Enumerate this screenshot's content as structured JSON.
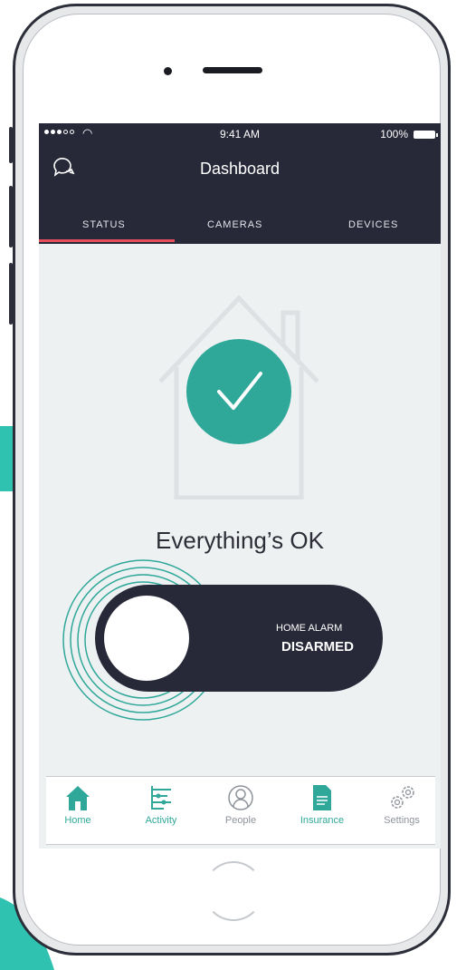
{
  "colors": {
    "accent_teal": "#2fa899",
    "navbar_dark": "#272838",
    "tab_underline": "#e84d5b",
    "screen_bg": "#eef1f2"
  },
  "status_bar": {
    "time": "9:41 AM",
    "battery_percent": "100%",
    "wifi_icon": "wifi-icon",
    "signal_icon": "signal-dots-icon"
  },
  "header": {
    "title": "Dashboard",
    "chat_icon": "chat-bubbles-icon"
  },
  "tabs": [
    {
      "label": "STATUS",
      "active": true
    },
    {
      "label": "CAMERAS",
      "active": false
    },
    {
      "label": "DEVICES",
      "active": false
    }
  ],
  "status": {
    "icon": "check-icon",
    "message": "Everything’s OK"
  },
  "alarm": {
    "label": "HOME ALARM",
    "state": "DISARMED"
  },
  "bottom_nav": [
    {
      "label": "Home",
      "icon": "house-icon",
      "active": true
    },
    {
      "label": "Activity",
      "icon": "activity-list-icon",
      "active": false
    },
    {
      "label": "People",
      "icon": "person-icon",
      "active": false
    },
    {
      "label": "Insurance",
      "icon": "document-icon",
      "active": false
    },
    {
      "label": "Settings",
      "icon": "gears-icon",
      "active": false
    }
  ]
}
